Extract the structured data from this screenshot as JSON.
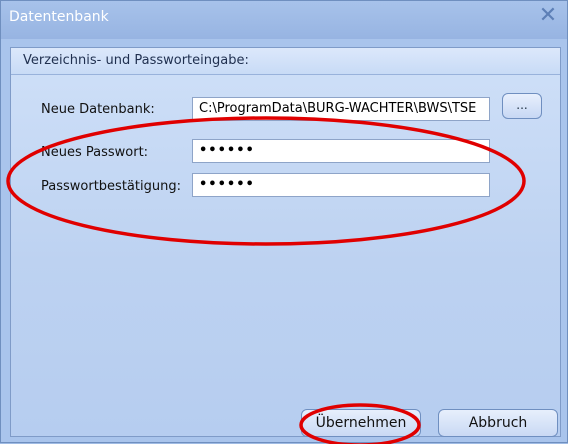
{
  "window": {
    "title": "Datentenbank"
  },
  "panel": {
    "title": "Verzeichnis- und Passworteingabe:"
  },
  "fields": {
    "database_label": "Neue Datenbank:",
    "database_value": "C:\\ProgramData\\BURG-WACHTER\\BWS\\TSE",
    "browse_label": "...",
    "password_label": "Neues Passwort:",
    "password_value": "••••••",
    "confirm_label": "Passwortbestätigung:",
    "confirm_value": "••••••"
  },
  "buttons": {
    "apply": "Übernehmen",
    "cancel": "Abbruch"
  },
  "icons": {
    "close": "close-icon"
  },
  "colors": {
    "annotation": "#e00000"
  }
}
